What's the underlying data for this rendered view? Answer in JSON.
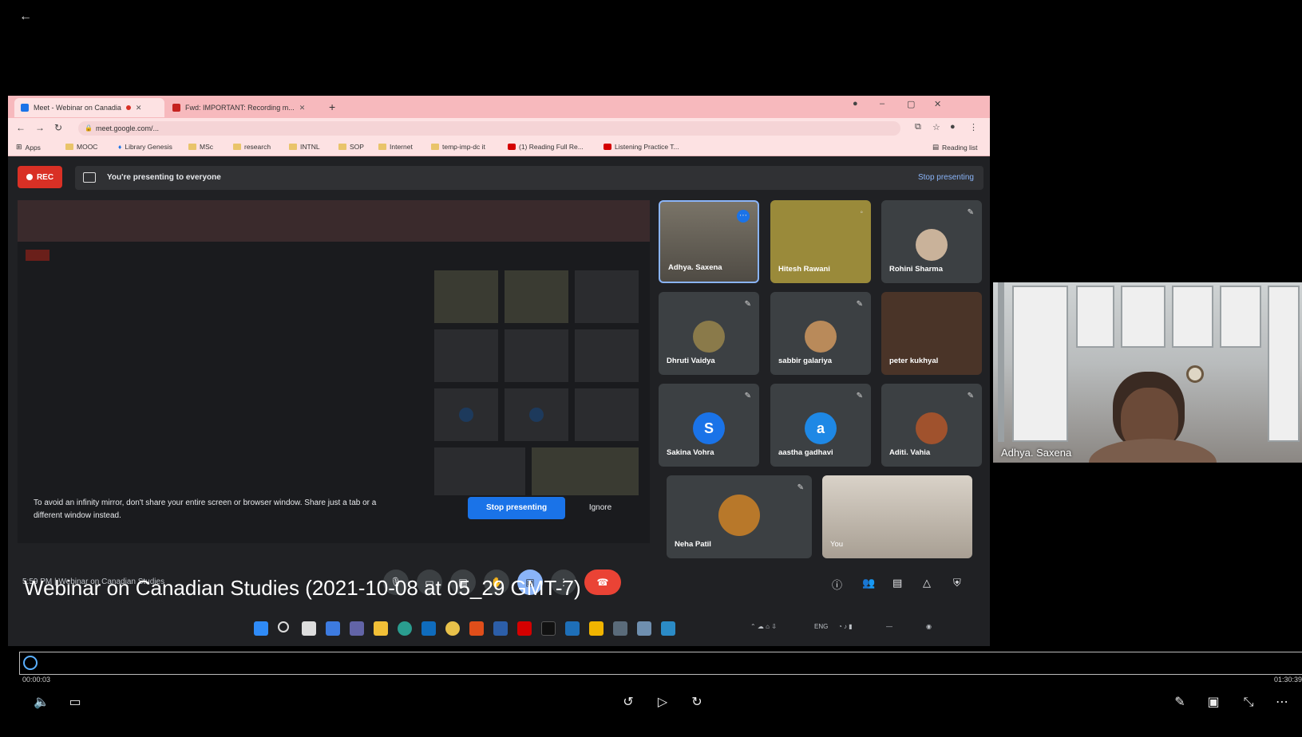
{
  "player": {
    "current_time": "00:00:03",
    "total_time": "01:30:39",
    "progress_fraction": 0.0,
    "caption": "Webinar on Canadian Studies (2021-10-08 at 05_29 GMT-7)"
  },
  "browser": {
    "tabs": [
      {
        "label": "Meet - Webinar on Canadia"
      },
      {
        "label": "Fwd: IMPORTANT: Recording m..."
      }
    ],
    "url": "meet.google.com/...",
    "bookmarks": [
      "Apps",
      "MOOC",
      "Library Genesis",
      "MSc",
      "research",
      "INTNL",
      "SOP",
      "Internet",
      "temp-imp-dc it",
      "(1) Reading Full Re...",
      "Listening Practice T..."
    ],
    "reading_list": "Reading list"
  },
  "meet": {
    "rec_label": "REC",
    "presenting_text": "You're presenting to everyone",
    "stop_presenting": "Stop presenting",
    "warning_text": "To avoid an infinity mirror, don't share your entire screen or browser window. Share just a tab or a different window instead.",
    "warning_stop": "Stop presenting",
    "warning_ignore": "Ignore",
    "meeting_info": "5:59 PM  |  Webinar on Canadian Studies",
    "participants": [
      {
        "name": "Adhya. Saxena",
        "initial": ""
      },
      {
        "name": "Hitesh Rawani",
        "initial": ""
      },
      {
        "name": "Rohini Sharma",
        "initial": ""
      },
      {
        "name": "Dhruti Vaidya",
        "initial": ""
      },
      {
        "name": "sabbir galariya",
        "initial": ""
      },
      {
        "name": "peter kukhyal",
        "initial": ""
      },
      {
        "name": "Sakina Vohra",
        "initial": "S"
      },
      {
        "name": "aastha gadhavi",
        "initial": "a"
      },
      {
        "name": "Aditi. Vahia",
        "initial": ""
      },
      {
        "name": "Neha Patil",
        "initial": ""
      },
      {
        "name": "You",
        "initial": ""
      }
    ]
  },
  "self_view": {
    "name": "Adhya. Saxena"
  },
  "colors": {
    "rec": "#d93025",
    "accent": "#8ab4f8",
    "end_call": "#ea4335",
    "tab_bar": "#f7b9bd"
  }
}
